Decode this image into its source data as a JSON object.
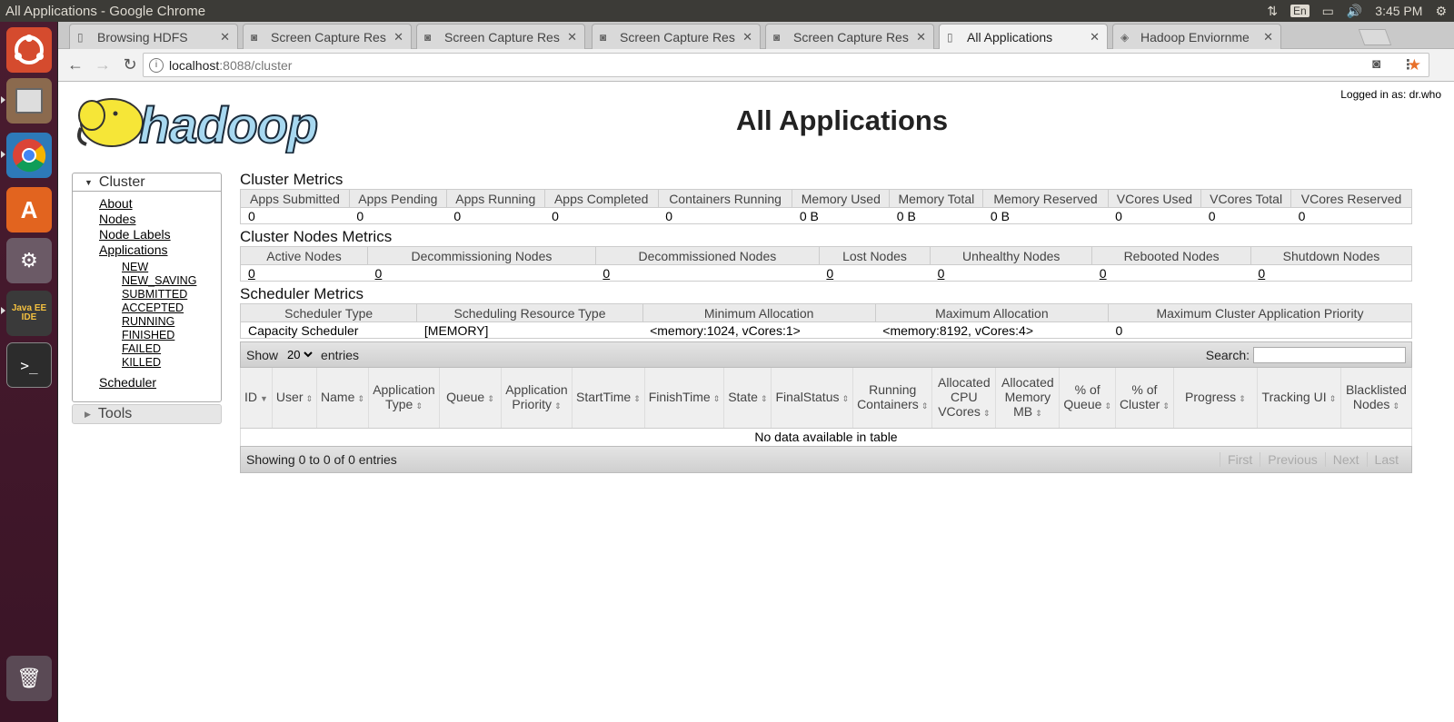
{
  "window": {
    "title": "All Applications - Google Chrome",
    "time": "3:45 PM",
    "lang": "En"
  },
  "tabs": [
    {
      "label": "Browsing HDFS",
      "icon": "page-icon"
    },
    {
      "label": "Screen Capture Res",
      "icon": "camera-icon"
    },
    {
      "label": "Screen Capture Res",
      "icon": "camera-icon"
    },
    {
      "label": "Screen Capture Res",
      "icon": "camera-icon"
    },
    {
      "label": "Screen Capture Res",
      "icon": "camera-icon"
    },
    {
      "label": "All Applications",
      "icon": "page-icon"
    },
    {
      "label": "Hadoop Enviornme",
      "icon": "hadoop-icon"
    }
  ],
  "address": {
    "host": "localhost",
    "rest": ":8088/cluster"
  },
  "page": {
    "title": "All Applications",
    "login": "Logged in as: dr.who",
    "logo_text": "hadoop"
  },
  "nav": {
    "cluster": "Cluster",
    "links": {
      "about": "About",
      "nodes": "Nodes",
      "node_labels": "Node Labels",
      "applications": "Applications",
      "scheduler": "Scheduler"
    },
    "states": [
      "NEW",
      "NEW_SAVING",
      "SUBMITTED",
      "ACCEPTED",
      "RUNNING",
      "FINISHED",
      "FAILED",
      "KILLED"
    ],
    "tools": "Tools"
  },
  "cluster_metrics": {
    "title": "Cluster Metrics",
    "headers": [
      "Apps Submitted",
      "Apps Pending",
      "Apps Running",
      "Apps Completed",
      "Containers Running",
      "Memory Used",
      "Memory Total",
      "Memory Reserved",
      "VCores Used",
      "VCores Total",
      "VCores Reserved"
    ],
    "values": [
      "0",
      "0",
      "0",
      "0",
      "0",
      "0 B",
      "0 B",
      "0 B",
      "0",
      "0",
      "0"
    ]
  },
  "node_metrics": {
    "title": "Cluster Nodes Metrics",
    "headers": [
      "Active Nodes",
      "Decommissioning Nodes",
      "Decommissioned Nodes",
      "Lost Nodes",
      "Unhealthy Nodes",
      "Rebooted Nodes",
      "Shutdown Nodes"
    ],
    "values": [
      "0",
      "0",
      "0",
      "0",
      "0",
      "0",
      "0"
    ]
  },
  "scheduler_metrics": {
    "title": "Scheduler Metrics",
    "headers": [
      "Scheduler Type",
      "Scheduling Resource Type",
      "Minimum Allocation",
      "Maximum Allocation",
      "Maximum Cluster Application Priority"
    ],
    "values": [
      "Capacity Scheduler",
      "[MEMORY]",
      "<memory:1024, vCores:1>",
      "<memory:8192, vCores:4>",
      "0"
    ]
  },
  "apps_table": {
    "show_label": "Show",
    "entries_value": "20",
    "entries_label": "entries",
    "search_label": "Search:",
    "columns": [
      "ID",
      "User",
      "Name",
      "Application Type",
      "Queue",
      "Application Priority",
      "StartTime",
      "FinishTime",
      "State",
      "FinalStatus",
      "Running Containers",
      "Allocated CPU VCores",
      "Allocated Memory MB",
      "% of Queue",
      "% of Cluster",
      "Progress",
      "Tracking UI",
      "Blacklisted Nodes"
    ],
    "empty": "No data available in table",
    "info": "Showing 0 to 0 of 0 entries",
    "pager": [
      "First",
      "Previous",
      "Next",
      "Last"
    ]
  }
}
